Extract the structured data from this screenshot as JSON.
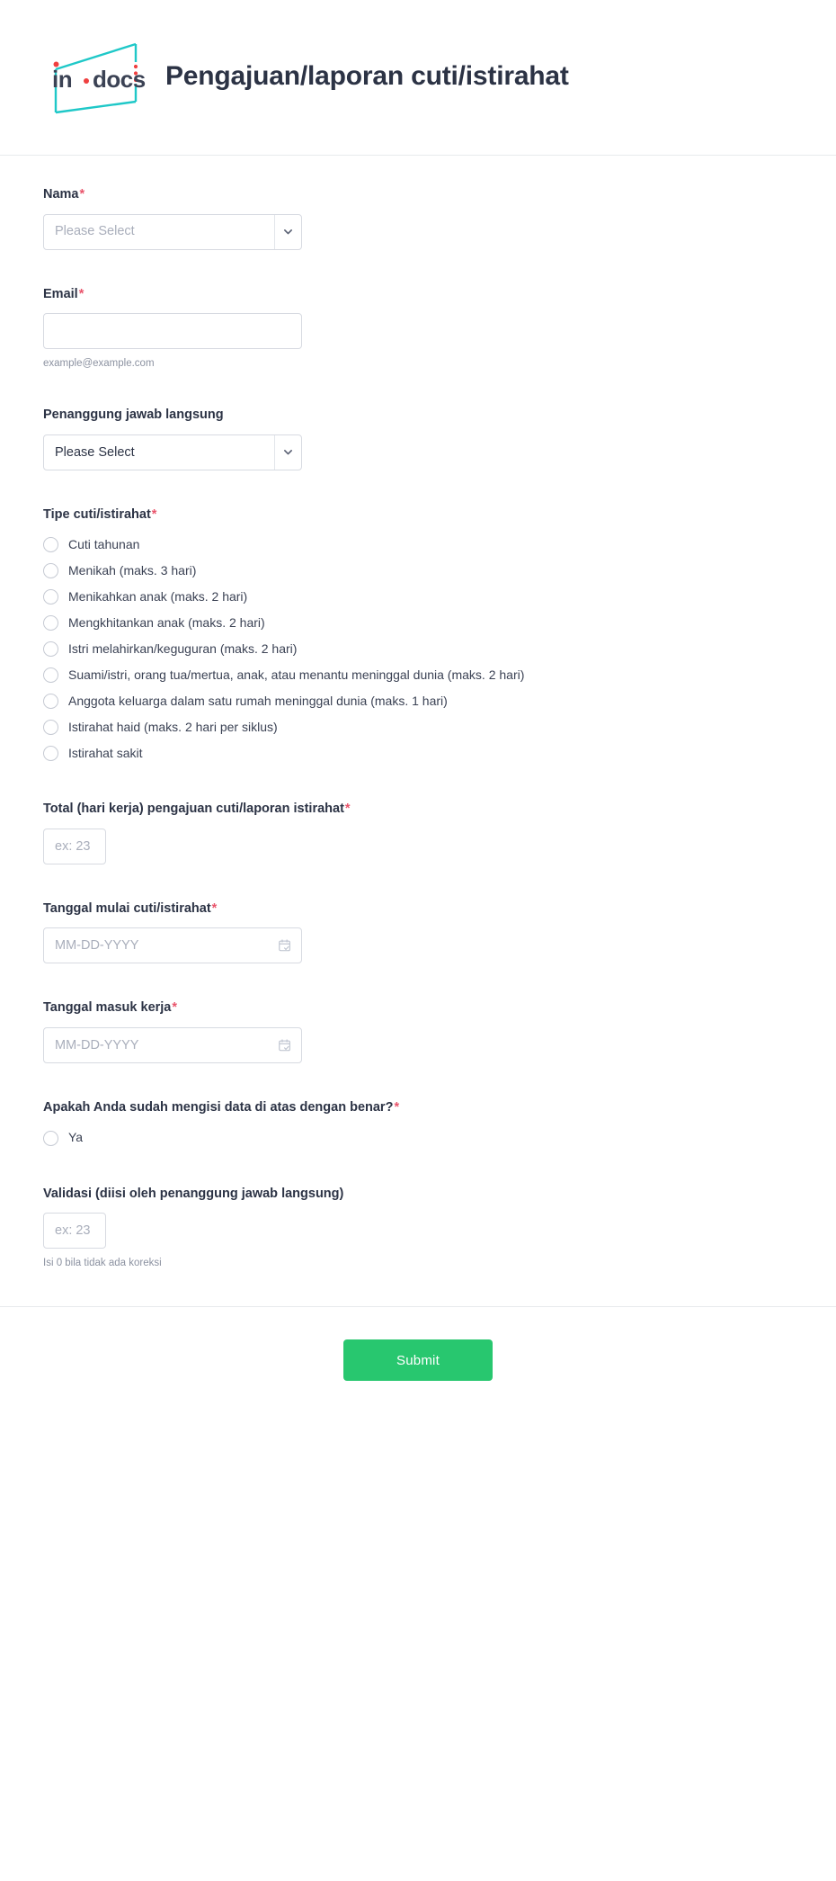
{
  "header": {
    "logo_text": "in·docs",
    "logo_name": "indocs-logo",
    "logo_frame_color": "#1fc8c8",
    "logo_text_color": "#3b4254",
    "logo_dot_color": "#ef4040",
    "title": "Pengajuan/laporan cuti/istirahat"
  },
  "theme": {
    "accent": "#28c76f",
    "required_mark": "#e9546b",
    "label_color": "#2c3345",
    "placeholder_color": "#a9aebb",
    "border_color": "#d7dae1"
  },
  "fields": {
    "nama": {
      "label": "Nama",
      "required_mark": "*",
      "control": "select",
      "value": "Please Select",
      "is_placeholder": true,
      "arrow_icon": "chevron-down-icon"
    },
    "email": {
      "label": "Email",
      "required_mark": "*",
      "control": "text",
      "value": "",
      "hint": "example@example.com"
    },
    "penanggung_jawab": {
      "label": "Penanggung jawab langsung",
      "required_mark": "",
      "control": "select",
      "value": "Please Select",
      "is_placeholder": false,
      "arrow_icon": "chevron-down-icon"
    },
    "tipe": {
      "label": "Tipe cuti/istirahat",
      "required_mark": "*",
      "control": "radio-group",
      "options": [
        "Cuti tahunan",
        "Menikah (maks. 3 hari)",
        "Menikahkan anak (maks. 2 hari)",
        "Mengkhitankan anak (maks. 2 hari)",
        "Istri melahirkan/keguguran (maks. 2 hari)",
        "Suami/istri, orang tua/mertua, anak, atau menantu meninggal dunia (maks. 2 hari)",
        "Anggota keluarga dalam satu rumah meninggal dunia (maks. 1 hari)",
        "Istirahat haid (maks. 2 hari per siklus)",
        "Istirahat sakit"
      ],
      "selected": null
    },
    "total_hari": {
      "label": "Total (hari kerja) pengajuan cuti/laporan istirahat",
      "required_mark": "*",
      "control": "number",
      "placeholder": "ex: 23",
      "value": ""
    },
    "tanggal_mulai": {
      "label": "Tanggal mulai cuti/istirahat",
      "required_mark": "*",
      "control": "date",
      "placeholder": "MM-DD-YYYY",
      "value": "",
      "icon": "calendar-icon"
    },
    "tanggal_masuk": {
      "label": "Tanggal masuk kerja",
      "required_mark": "*",
      "control": "date",
      "placeholder": "MM-DD-YYYY",
      "value": "",
      "icon": "calendar-icon"
    },
    "konfirmasi": {
      "label": "Apakah Anda sudah mengisi data di atas dengan benar?",
      "required_mark": "*",
      "control": "radio-group",
      "options": [
        "Ya"
      ],
      "selected": null
    },
    "validasi": {
      "label": "Validasi (diisi oleh penanggung jawab langsung)",
      "required_mark": "",
      "control": "number",
      "placeholder": "ex: 23",
      "value": "",
      "hint": "Isi 0 bila tidak ada koreksi"
    }
  },
  "footer": {
    "submit_label": "Submit"
  }
}
